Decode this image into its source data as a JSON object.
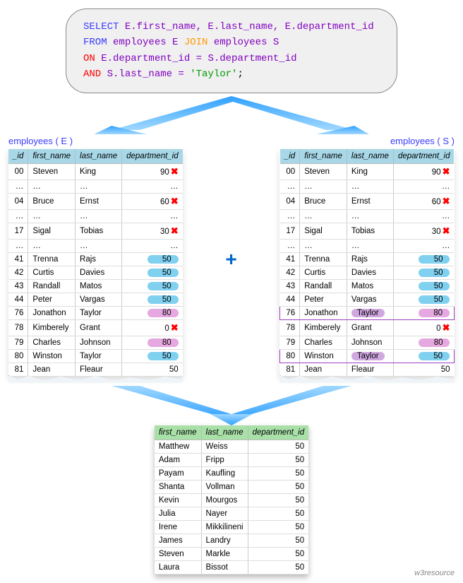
{
  "query": {
    "line1_pre": "SELECT ",
    "line1_cols": "E.first_name, E.last_name, E.department_id",
    "line2_from": "FROM ",
    "line2_t1": "employees E ",
    "line2_join": "JOIN ",
    "line2_t2": "employees S",
    "line3_on": "ON ",
    "line3_cond": "E.department_id = S.department_id",
    "line4_and": "AND ",
    "line4_left": "S.last_name = ",
    "line4_val": "'Taylor'",
    "line4_end": ";"
  },
  "labels": {
    "tableE": "employees ( E )",
    "tableS": "employees ( S )",
    "plus": "+"
  },
  "headers": {
    "id": "_id",
    "fn": "first_name",
    "ln": "last_name",
    "dep": "department_id"
  },
  "tableE": {
    "rows": [
      {
        "id": "00",
        "fn": "Steven",
        "ln": "King",
        "dep": "90",
        "pill": "",
        "x": true,
        "ring": false
      },
      {
        "id": "…",
        "fn": "…",
        "ln": "…",
        "dep": "…",
        "pill": "",
        "x": false,
        "ring": false
      },
      {
        "id": "04",
        "fn": "Bruce",
        "ln": "Ernst",
        "dep": "60",
        "pill": "",
        "x": true,
        "ring": false
      },
      {
        "id": "…",
        "fn": "…",
        "ln": "…",
        "dep": "…",
        "pill": "",
        "x": false,
        "ring": false
      },
      {
        "id": "17",
        "fn": "Sigal",
        "ln": "Tobias",
        "dep": "30",
        "pill": "",
        "x": true,
        "ring": false
      },
      {
        "id": "…",
        "fn": "…",
        "ln": "…",
        "dep": "…",
        "pill": "",
        "x": false,
        "ring": false
      },
      {
        "id": "41",
        "fn": "Trenna",
        "ln": "Rajs",
        "dep": "50",
        "pill": "blue",
        "x": false,
        "ring": false
      },
      {
        "id": "42",
        "fn": "Curtis",
        "ln": "Davies",
        "dep": "50",
        "pill": "blue",
        "x": false,
        "ring": false
      },
      {
        "id": "43",
        "fn": "Randall",
        "ln": "Matos",
        "dep": "50",
        "pill": "blue",
        "x": false,
        "ring": false
      },
      {
        "id": "44",
        "fn": "Peter",
        "ln": "Vargas",
        "dep": "50",
        "pill": "blue",
        "x": false,
        "ring": false
      },
      {
        "id": "76",
        "fn": "Jonathon",
        "ln": "Taylor",
        "dep": "80",
        "pill": "pink",
        "x": false,
        "ring": false
      },
      {
        "id": "78",
        "fn": "Kimberely",
        "ln": "Grant",
        "dep": "0",
        "pill": "",
        "x": true,
        "ring": false
      },
      {
        "id": "79",
        "fn": "Charles",
        "ln": "Johnson",
        "dep": "80",
        "pill": "pink",
        "x": false,
        "ring": false
      },
      {
        "id": "80",
        "fn": "Winston",
        "ln": "Taylor",
        "dep": "50",
        "pill": "blue",
        "x": false,
        "ring": false
      },
      {
        "id": "81",
        "fn": "Jean",
        "ln": "Fleaur",
        "dep": "50",
        "pill": "",
        "x": false,
        "ring": false
      }
    ]
  },
  "tableS": {
    "rows": [
      {
        "id": "00",
        "fn": "Steven",
        "ln": "King",
        "lnPill": false,
        "dep": "90",
        "pill": "",
        "x": true,
        "ring": false
      },
      {
        "id": "…",
        "fn": "…",
        "ln": "…",
        "lnPill": false,
        "dep": "…",
        "pill": "",
        "x": false,
        "ring": false
      },
      {
        "id": "04",
        "fn": "Bruce",
        "ln": "Ernst",
        "lnPill": false,
        "dep": "60",
        "pill": "",
        "x": true,
        "ring": false
      },
      {
        "id": "…",
        "fn": "…",
        "ln": "…",
        "lnPill": false,
        "dep": "…",
        "pill": "",
        "x": false,
        "ring": false
      },
      {
        "id": "17",
        "fn": "Sigal",
        "ln": "Tobias",
        "lnPill": false,
        "dep": "30",
        "pill": "",
        "x": true,
        "ring": false
      },
      {
        "id": "…",
        "fn": "…",
        "ln": "…",
        "lnPill": false,
        "dep": "…",
        "pill": "",
        "x": false,
        "ring": false
      },
      {
        "id": "41",
        "fn": "Trenna",
        "ln": "Rajs",
        "lnPill": false,
        "dep": "50",
        "pill": "blue",
        "x": false,
        "ring": false
      },
      {
        "id": "42",
        "fn": "Curtis",
        "ln": "Davies",
        "lnPill": false,
        "dep": "50",
        "pill": "blue",
        "x": false,
        "ring": false
      },
      {
        "id": "43",
        "fn": "Randall",
        "ln": "Matos",
        "lnPill": false,
        "dep": "50",
        "pill": "blue",
        "x": false,
        "ring": false
      },
      {
        "id": "44",
        "fn": "Peter",
        "ln": "Vargas",
        "lnPill": false,
        "dep": "50",
        "pill": "blue",
        "x": false,
        "ring": false
      },
      {
        "id": "76",
        "fn": "Jonathon",
        "ln": "Taylor",
        "lnPill": true,
        "dep": "80",
        "pill": "pink",
        "x": false,
        "ring": true
      },
      {
        "id": "78",
        "fn": "Kimberely",
        "ln": "Grant",
        "lnPill": false,
        "dep": "0",
        "pill": "",
        "x": true,
        "ring": false
      },
      {
        "id": "79",
        "fn": "Charles",
        "ln": "Johnson",
        "lnPill": false,
        "dep": "80",
        "pill": "pink",
        "x": false,
        "ring": false
      },
      {
        "id": "80",
        "fn": "Winston",
        "ln": "Taylor",
        "lnPill": true,
        "dep": "50",
        "pill": "blue",
        "x": false,
        "ring": true
      },
      {
        "id": "81",
        "fn": "Jean",
        "ln": "Fleaur",
        "lnPill": false,
        "dep": "50",
        "pill": "",
        "x": false,
        "ring": false
      }
    ]
  },
  "result": {
    "rows": [
      {
        "fn": "Matthew",
        "ln": "Weiss",
        "dep": "50"
      },
      {
        "fn": "Adam",
        "ln": "Fripp",
        "dep": "50"
      },
      {
        "fn": "Payam",
        "ln": "Kaufling",
        "dep": "50"
      },
      {
        "fn": "Shanta",
        "ln": "Vollman",
        "dep": "50"
      },
      {
        "fn": "Kevin",
        "ln": "Mourgos",
        "dep": "50"
      },
      {
        "fn": "Julia",
        "ln": "Nayer",
        "dep": "50"
      },
      {
        "fn": "Irene",
        "ln": "Mikkilineni",
        "dep": "50"
      },
      {
        "fn": "James",
        "ln": "Landry",
        "dep": "50"
      },
      {
        "fn": "Steven",
        "ln": "Markle",
        "dep": "50"
      },
      {
        "fn": "Laura",
        "ln": "Bissot",
        "dep": "50"
      }
    ]
  },
  "credit": "w3resource"
}
